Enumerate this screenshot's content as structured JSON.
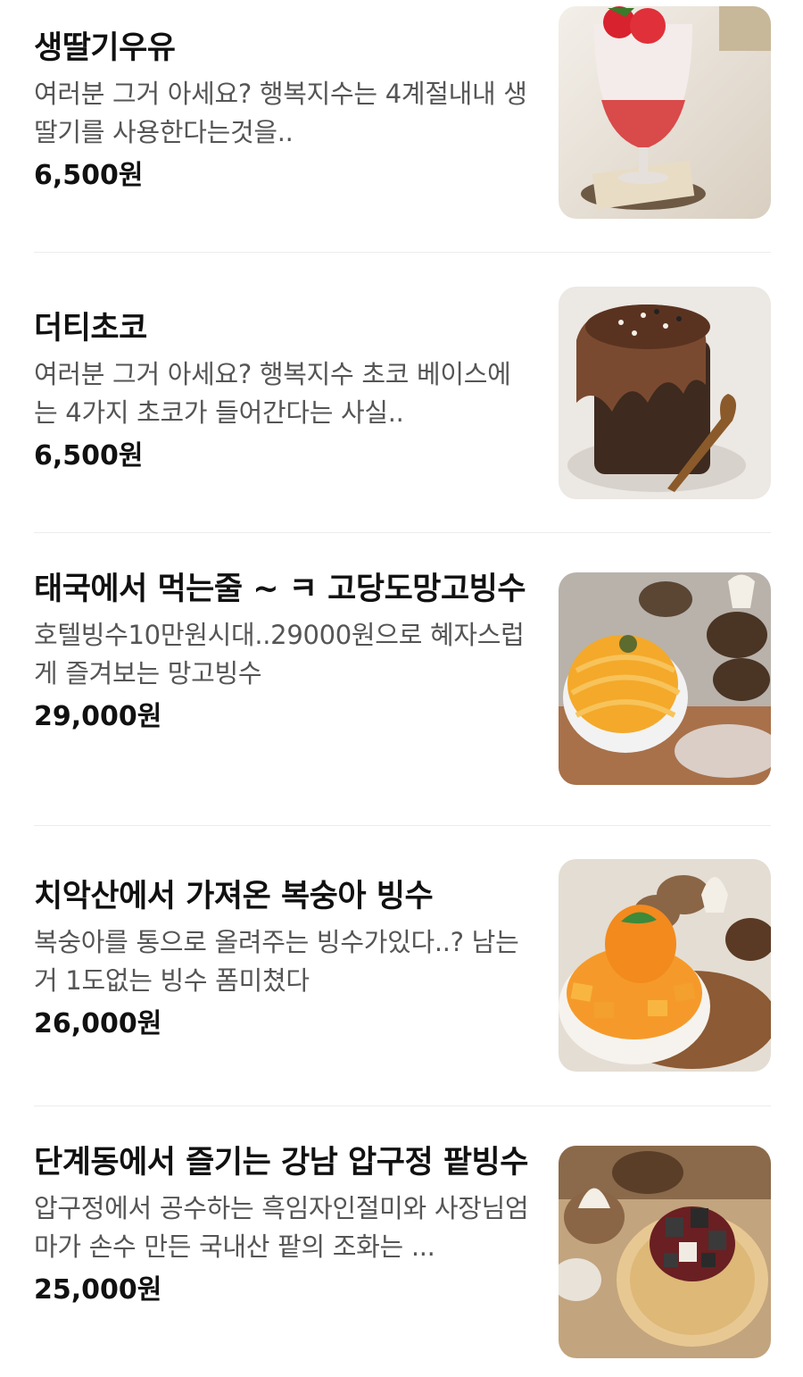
{
  "menu": {
    "items": [
      {
        "title": "생딸기우유",
        "description": "여러분 그거 아세요? 행복지수는 4계절내내 생딸기를 사용한다는것을..",
        "price": "6,500원",
        "image": "strawberry-milk-photo"
      },
      {
        "title": "더티초코",
        "description": "여러분 그거 아세요? 행복지수 초코 베이스에는 4가지 초코가 들어간다는 사실..",
        "price": "6,500원",
        "image": "dirty-choco-photo"
      },
      {
        "title": "태국에서 먹는줄 ~ ㅋ 고당도망고빙수",
        "description": "호텔빙수10만원시대..29000원으로 혜자스럽게 즐겨보는 망고빙수",
        "price": "29,000원",
        "image": "mango-bingsu-photo"
      },
      {
        "title": "치악산에서 가져온 복숭아 빙수",
        "description": "복숭아를 통으로 올려주는 빙수가있다..? 남는거 1도없는 빙수 폼미쳤다",
        "price": "26,000원",
        "image": "peach-bingsu-photo"
      },
      {
        "title": "단계동에서 즐기는 강남 압구정 팥빙수",
        "description": "압구정에서 공수하는 흑임자인절미와 사장님엄마가 손수 만든 국내산 팥의 조화는 ...",
        "price": "25,000원",
        "image": "red-bean-bingsu-photo"
      }
    ]
  },
  "colors": {
    "text": "#111111",
    "description": "#555555",
    "divider": "#ececec"
  }
}
